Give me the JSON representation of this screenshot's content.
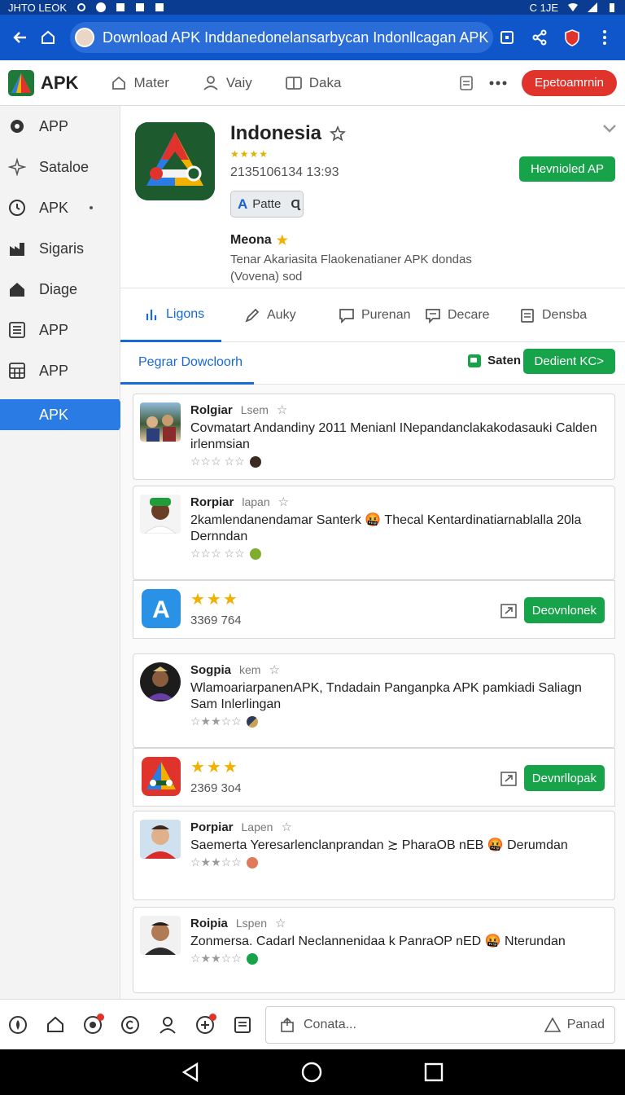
{
  "status": {
    "left_text": "JHTO LEOK",
    "right_text": "C 1JE"
  },
  "browser": {
    "url": "Download APK Inddanedonelansarbycan Indonllcagan APK"
  },
  "app": {
    "brand": "APK",
    "nav": [
      "Mater",
      "Vaiy",
      "Daka"
    ],
    "action_label": "Epetoamrnin"
  },
  "sidebar": {
    "items": [
      {
        "label": "APP",
        "icon": "gear-icon"
      },
      {
        "label": "Sataloe",
        "icon": "sparkle-icon"
      },
      {
        "label": "APK",
        "icon": "clock-icon"
      },
      {
        "label": "Sigaris",
        "icon": "factory-icon"
      },
      {
        "label": "Diage",
        "icon": "home-icon"
      },
      {
        "label": "APP",
        "icon": "list-icon"
      },
      {
        "label": "APP",
        "icon": "grid-icon"
      },
      {
        "label": "APK",
        "icon": "",
        "active": true
      }
    ]
  },
  "hero": {
    "title": "Indonesia",
    "stars": "★★★★",
    "meta": "2135106134 13:93",
    "chip_letter": "A",
    "chip_label": "Patte",
    "chip_glyph": "Ɋ",
    "download_label": "Hevnioled AP",
    "sub_title": "Meona",
    "desc": "Tenar Akariasita Flaokenatianer APK dondas (Vovena) sod"
  },
  "tabs": [
    {
      "label": "Ligons",
      "icon": "chart-icon",
      "active": true
    },
    {
      "label": "Auky",
      "icon": "pen-icon"
    },
    {
      "label": "Purenan",
      "icon": "message-icon"
    },
    {
      "label": "Decare",
      "icon": "comment-icon"
    },
    {
      "label": "Densba",
      "icon": "doc-icon"
    }
  ],
  "subbar": {
    "tab_label": "Pegrar Dowcloorh",
    "saten_label": "Saten",
    "button_label": "Dedient KC>"
  },
  "reviews": [
    {
      "name": "Rolgiar",
      "tag": "Lsem",
      "text": "Covmatart Andandiny 2011 Menianl INepandanclakakodasauki Calden irlenmsian",
      "stars": "☆☆☆ ☆☆"
    },
    {
      "name": "Rorpiar",
      "tag": "lapan",
      "text": "2kamlendanendamar Santerk 🤬 Thecal Kentardinatiarnablalla 20la Dernndan",
      "stars": "☆☆☆ ☆☆"
    },
    {
      "name": "Sogpia",
      "tag": "kem",
      "text": "WlamoariarpanenAPK, Tndadain Panganpka APK pamkiadi Saliagn Sam Inlerlingan",
      "stars": "☆★★☆☆"
    },
    {
      "name": "Porpiar",
      "tag": "Lapen",
      "text": "Saemerta Yeresarlenclanprandan ≿ PharaOB nEB 🤬 Derumdan",
      "stars": "☆★★☆☆"
    },
    {
      "name": "Roipia",
      "tag": "Lspen",
      "text": "Zonmersa. Cadarl Neclannenidaa k PanraOP nED 🤬 Nterundan",
      "stars": "☆★★☆☆"
    }
  ],
  "appcards": [
    {
      "stars": "★★★",
      "size": "3369 764",
      "button_label": "Deovnlonek"
    },
    {
      "stars": "★★★",
      "size": "2369 3o4",
      "button_label": "Devnrllopak"
    }
  ],
  "bottom": {
    "comment_placeholder": "Conata...",
    "comment_action": "Panad"
  },
  "colors": {
    "primary": "#0e56c9",
    "accent": "#1769d8",
    "success": "#16a34a",
    "danger": "#e0332b"
  }
}
